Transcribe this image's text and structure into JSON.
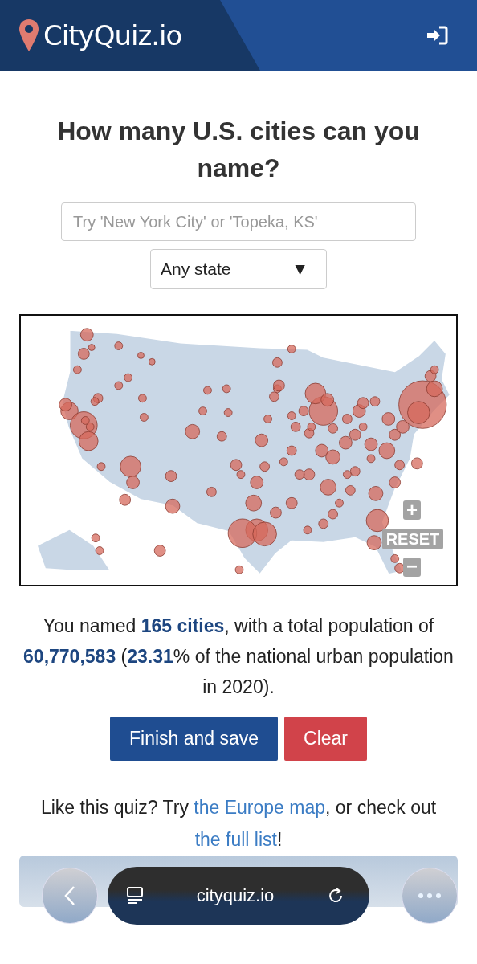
{
  "header": {
    "logo_text": "CityQuiz.io"
  },
  "heading": "How many U.S. cities can you name?",
  "search": {
    "placeholder": "Try 'New York City' or 'Topeka, KS'"
  },
  "state_select": {
    "value": "Any state",
    "caret": "▼"
  },
  "map": {
    "zoom_in": "+",
    "reset": "RESET",
    "zoom_out": "−"
  },
  "summary": "You named **165 cities**, with a total population of **60,770,583** (**23.31**% of the national urban population in 2020).",
  "buttons": [
    {
      "kind": "primary",
      "label": "Finish and save"
    },
    {
      "kind": "danger",
      "label": "Clear"
    }
  ],
  "footer": {
    "before": "Like this quiz? Try ",
    "link_1": "the Europe map",
    "middle": ", or check out ",
    "link_2": "the full list",
    "after": "!"
  },
  "browser_bar": {
    "url": "cityquiz.io"
  }
}
